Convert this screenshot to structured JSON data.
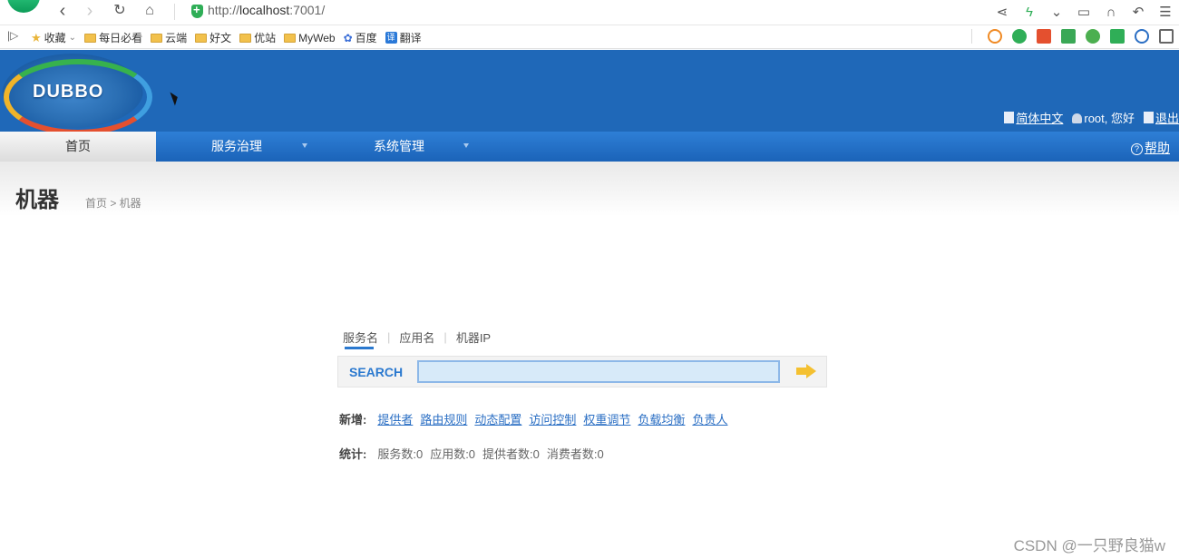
{
  "browser": {
    "url_scheme": "http://",
    "url_host": "localhost",
    "url_rest": ":7001/",
    "bookmarks": [
      {
        "label": "收藏",
        "icon": "star-icon"
      },
      {
        "label": "每日必看",
        "icon": "folder-icon"
      },
      {
        "label": "云端",
        "icon": "folder-icon"
      },
      {
        "label": "好文",
        "icon": "folder-icon"
      },
      {
        "label": "优站",
        "icon": "folder-icon"
      },
      {
        "label": "MyWeb",
        "icon": "folder-icon"
      },
      {
        "label": "百度",
        "icon": "paw-icon"
      },
      {
        "label": "翻译",
        "icon": "translate-icon"
      }
    ]
  },
  "app": {
    "logo_text": "DUBBO",
    "user_bar": {
      "language": "简体中文",
      "greeting": "root, 您好",
      "logout": "退出"
    },
    "nav": {
      "home": "首页",
      "service_governance": "服务治理",
      "system_management": "系统管理",
      "help": "帮助"
    },
    "page": {
      "title": "机器",
      "breadcrumb": "首页 > 机器"
    },
    "search": {
      "tabs": [
        "服务名",
        "应用名",
        "机器IP"
      ],
      "label": "SEARCH",
      "value": ""
    },
    "add_row": {
      "label": "新增:",
      "links": [
        "提供者",
        "路由规则",
        "动态配置",
        "访问控制",
        "权重调节",
        "负载均衡",
        "负责人"
      ]
    },
    "stats_row": {
      "label": "统计:",
      "items": [
        "服务数:0",
        "应用数:0",
        "提供者数:0",
        "消费者数:0"
      ]
    }
  },
  "watermark": "CSDN @一只野良猫w"
}
